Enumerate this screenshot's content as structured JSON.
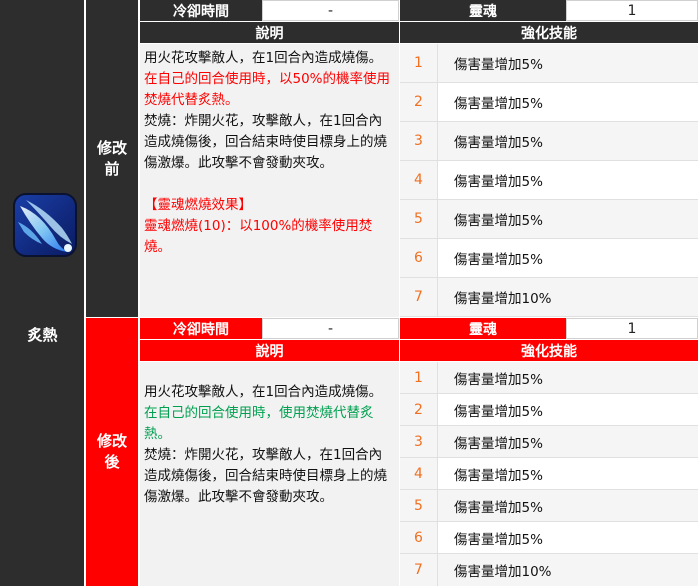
{
  "skill": {
    "name": "炙熱",
    "icon": "flame-slash-icon"
  },
  "before": {
    "label": "修改前",
    "cooldown_label": "冷卻時間",
    "cooldown_value": "-",
    "soul_label": "靈魂",
    "soul_value": "1",
    "desc_header": "說明",
    "enh_header": "強化技能",
    "desc": {
      "line1": "用火花攻擊敵人，在1回合內造成燒傷。",
      "line2_red": "在自己的回合使用時，以50%的機率使用焚燒代替炙熱。",
      "line3": "焚燒：炸開火花，攻擊敵人，在1回合內造成燒傷後，回合結束時使目標身上的燒傷激爆。此攻擊不會發動夾攻。",
      "line4_red": "【靈魂燃燒效果】",
      "line5_red": "靈魂燃燒(10)：以100%的機率使用焚燒。"
    },
    "enhancements": [
      {
        "num": "1",
        "text": "傷害量增加5%"
      },
      {
        "num": "2",
        "text": "傷害量增加5%"
      },
      {
        "num": "3",
        "text": "傷害量增加5%"
      },
      {
        "num": "4",
        "text": "傷害量增加5%"
      },
      {
        "num": "5",
        "text": "傷害量增加5%"
      },
      {
        "num": "6",
        "text": "傷害量增加5%"
      },
      {
        "num": "7",
        "text": "傷害量增加10%"
      }
    ]
  },
  "after": {
    "label": "修改後",
    "cooldown_label": "冷卻時間",
    "cooldown_value": "-",
    "soul_label": "靈魂",
    "soul_value": "1",
    "desc_header": "說明",
    "enh_header": "強化技能",
    "desc": {
      "line1": "用火花攻擊敵人，在1回合內造成燒傷。",
      "line2_green": "在自己的回合使用時，使用焚燒代替炙熱。",
      "line3": "焚燒：炸開火花，攻擊敵人，在1回合內造成燒傷後，回合結束時使目標身上的燒傷激爆。此攻擊不會發動夾攻。"
    },
    "enhancements": [
      {
        "num": "1",
        "text": "傷害量增加5%"
      },
      {
        "num": "2",
        "text": "傷害量增加5%"
      },
      {
        "num": "3",
        "text": "傷害量增加5%"
      },
      {
        "num": "4",
        "text": "傷害量增加5%"
      },
      {
        "num": "5",
        "text": "傷害量增加5%"
      },
      {
        "num": "6",
        "text": "傷害量增加5%"
      },
      {
        "num": "7",
        "text": "傷害量增加10%"
      }
    ]
  },
  "colors": {
    "dark_header": "#2d2d2d",
    "red_header": "#ff0000",
    "red_text": "#ff0000",
    "green_text": "#00a050",
    "number_orange": "#f07020"
  }
}
